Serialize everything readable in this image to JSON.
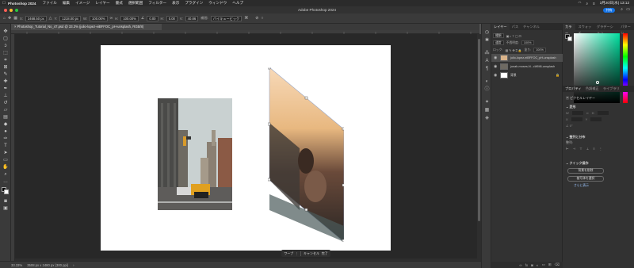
{
  "menubar": {
    "app_name": "Photoshop 2024",
    "items": [
      "ファイル",
      "編集",
      "イメージ",
      "レイヤー",
      "書式",
      "選択範囲",
      "フィルター",
      "表示",
      "プラグイン",
      "ウィンドウ",
      "ヘルプ"
    ],
    "clock": "3月20日(水) 13:12"
  },
  "window": {
    "title": "Adobe Photoshop 2024",
    "share_label": "共有"
  },
  "options": {
    "x_label": "X:",
    "x_value": "2468.50 px",
    "y_label": "Y:",
    "y_value": "1218.00 px",
    "w_label": "W:",
    "w_value": "100.00%",
    "h_label": "H:",
    "h_value": "100.00%",
    "angle_value": "0.00",
    "skew_h": "0.00",
    "skew_v": "40.86",
    "interp_label": "補間:",
    "interp_value": "バイキュービック"
  },
  "document": {
    "tab_label": "Photoshop_Tutorial_No_47.psd @ 33.3% (julio-lopez-eiBFFOC_pH-unsplash, RGB/8)"
  },
  "commit": {
    "warp_label": "ワープ",
    "cancel_label": "キャンセル",
    "commit_label": "完了"
  },
  "status": {
    "zoom": "33.33%",
    "doc_size": "3508 px x 2480 px (300 ppi)"
  },
  "layers_panel": {
    "tabs": [
      "レイヤー",
      "パス",
      "チャンネル"
    ],
    "kind_label": "種類",
    "blend_mode": "通常",
    "opacity_label": "不透明度:",
    "opacity_value": "100%",
    "lock_label": "ロック:",
    "fill_label": "塗り:",
    "fill_value": "100%",
    "layers": [
      {
        "name": "julio-lopez-eiBFFOC_pH-unsplash",
        "selected": true
      },
      {
        "name": "jonah-moses-N...cWM6-unsplash",
        "selected": false
      },
      {
        "name": "背景",
        "selected": false
      }
    ]
  },
  "color_panel": {
    "tabs": [
      "カラー",
      "スウォッチ",
      "グラデーション",
      "パターン"
    ]
  },
  "properties_panel": {
    "tabs": [
      "プロパティ",
      "色調補正",
      "ライブラリ"
    ],
    "layer_type": "ピクセルレイヤー",
    "transform_title": "変形",
    "align_title": "整列と分布",
    "align_sub": "整列:",
    "quick_actions_title": "クイック操作",
    "btn_remove_bg": "背景を削除",
    "btn_select_subject": "被写体を選択",
    "more_link": "さらに表示",
    "w_label": "W",
    "h_label": "H",
    "x_label": "X",
    "y_label": "Y",
    "angle_value": "0°"
  },
  "accent_colors": {
    "selection": "#1473e6",
    "teal": "#00e0a0"
  }
}
